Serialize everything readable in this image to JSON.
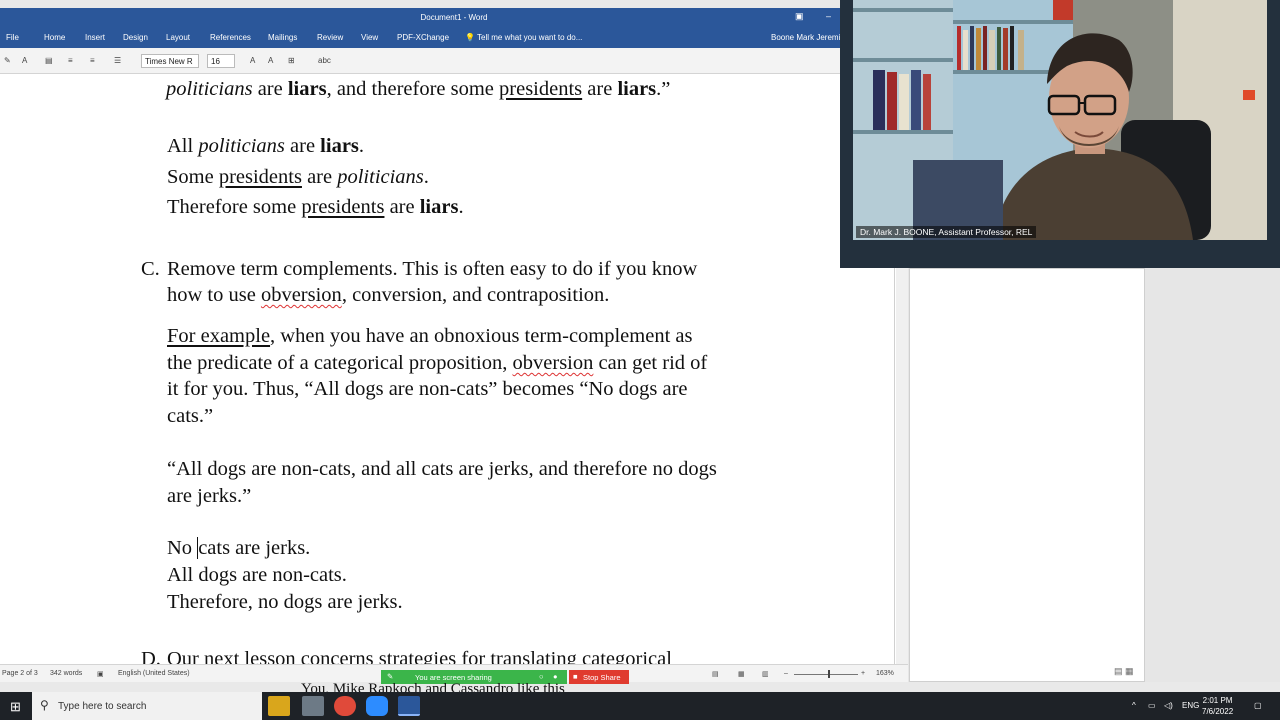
{
  "word": {
    "title": "Document1 - Word",
    "user": "Boone Mark Jeremi",
    "menu": [
      "File",
      "Home",
      "Insert",
      "Design",
      "Layout",
      "References",
      "Mailings",
      "Review",
      "View",
      "PDF-XChange"
    ],
    "tell_me": "Tell me what you want to do...",
    "font_name": "Times New R",
    "font_size": "16"
  },
  "document": {
    "l1_a": "politicians",
    "l1_b": " are ",
    "l1_c": "liars",
    "l1_d": ", and therefore some ",
    "l1_e": "presidents",
    "l1_f": " are ",
    "l1_g": "liars",
    "l1_h": ".”",
    "l2_a": "All ",
    "l2_b": "politicians",
    "l2_c": " are ",
    "l2_d": "liars",
    "l2_e": ".",
    "l3_a": "Some ",
    "l3_b": "presidents",
    "l3_c": " are ",
    "l3_d": "politicians",
    "l3_e": ".",
    "l4_a": "Therefore some ",
    "l4_b": "presidents",
    "l4_c": " are ",
    "l4_d": "liars",
    "l4_e": ".",
    "c_label": "C.",
    "c1": "Remove term complements.  This is often easy to do if you know",
    "c2_a": "how to use ",
    "c2_b": "obversion",
    "c2_c": ", conversion, and contraposition.",
    "p1_a": "For example",
    "p1_b": ", when you have an obnoxious term-complement as",
    "p2_a": "the predicate of a categorical proposition, ",
    "p2_b": "obversion",
    "p2_c": " can get rid of",
    "p3": "it for you.  Thus, “All dogs are non-cats” becomes “No dogs are",
    "p4": "cats.”",
    "q1": "“All dogs are non-cats, and all cats are jerks, and therefore no dogs",
    "q2": "are jerks.”",
    "s1_a": "No ",
    "s1_b": "cats are jerks.",
    "s2": "All dogs are non-cats.",
    "s3": "Therefore, no dogs are jerks.",
    "d_label": "D.",
    "d1": "Our next lesson concerns strategies for translating categorical"
  },
  "status": {
    "page": "Page 2 of 3",
    "words": "342 words",
    "language": "English (United States)",
    "zoom": "163%"
  },
  "screen_share": {
    "message": "You are screen sharing",
    "stop_label": "Stop Share"
  },
  "caption": "You, Mike Rapkoch and Cassandro like this",
  "camera": {
    "name_tag": "Dr. Mark J. BOONE, Assistant Professor, REL"
  },
  "taskbar": {
    "search_placeholder": "Type here to search",
    "language": "ENG",
    "time": "2:01 PM",
    "date": "7/6/2022"
  },
  "colors": {
    "word_blue": "#2b579a",
    "share_green": "#3bb54a",
    "stop_red": "#e03b2f",
    "taskbar": "#1e2227"
  }
}
